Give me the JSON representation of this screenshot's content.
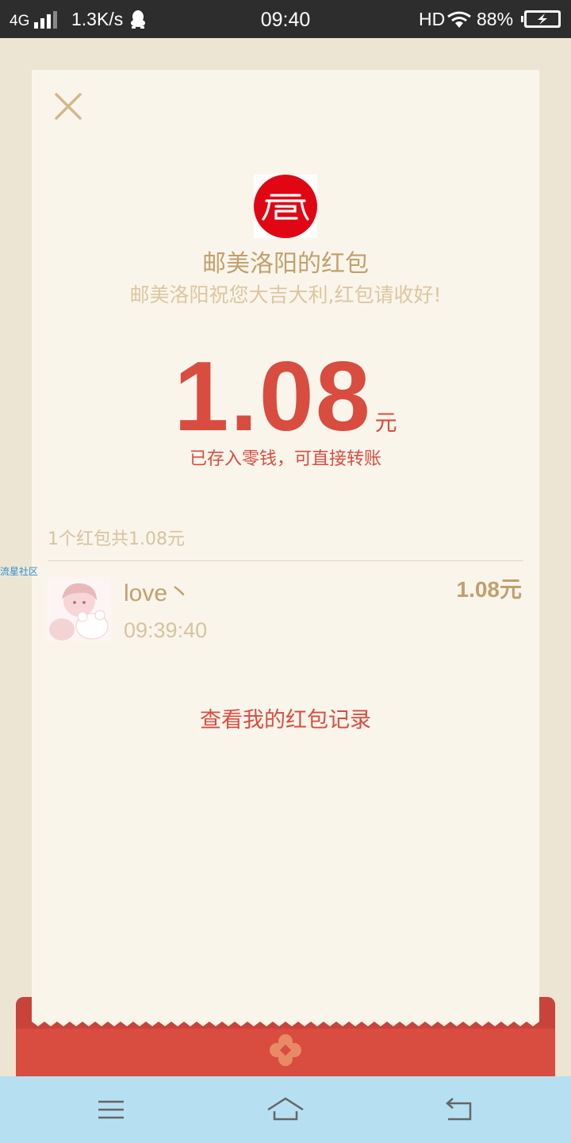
{
  "status_bar": {
    "network": "4G",
    "speed": "1.3K/s",
    "time": "09:40",
    "hd": "HD",
    "battery": "88%"
  },
  "header": {
    "sender_title": "邮美洛阳的红包",
    "greeting": "邮美洛阳祝您大吉大利,红包请收好!"
  },
  "amount": {
    "value": "1.08",
    "unit": "元",
    "note": "已存入零钱，可直接转账"
  },
  "summary": "1个红包共1.08元",
  "watermark": "流星社区",
  "records": [
    {
      "name": "love丶",
      "time": "09:39:40",
      "amount": "1.08元"
    }
  ],
  "history_link": "查看我的红包记录",
  "colors": {
    "red": "#d94c40",
    "gold": "#c0a06e",
    "card": "#faf5eb",
    "page": "#ede5d3",
    "nav": "#b7dff2"
  },
  "icons": {
    "close": "close-icon",
    "logo": "sender-logo-icon",
    "nav_menu": "menu-icon",
    "nav_home": "home-icon",
    "nav_back": "back-icon"
  }
}
